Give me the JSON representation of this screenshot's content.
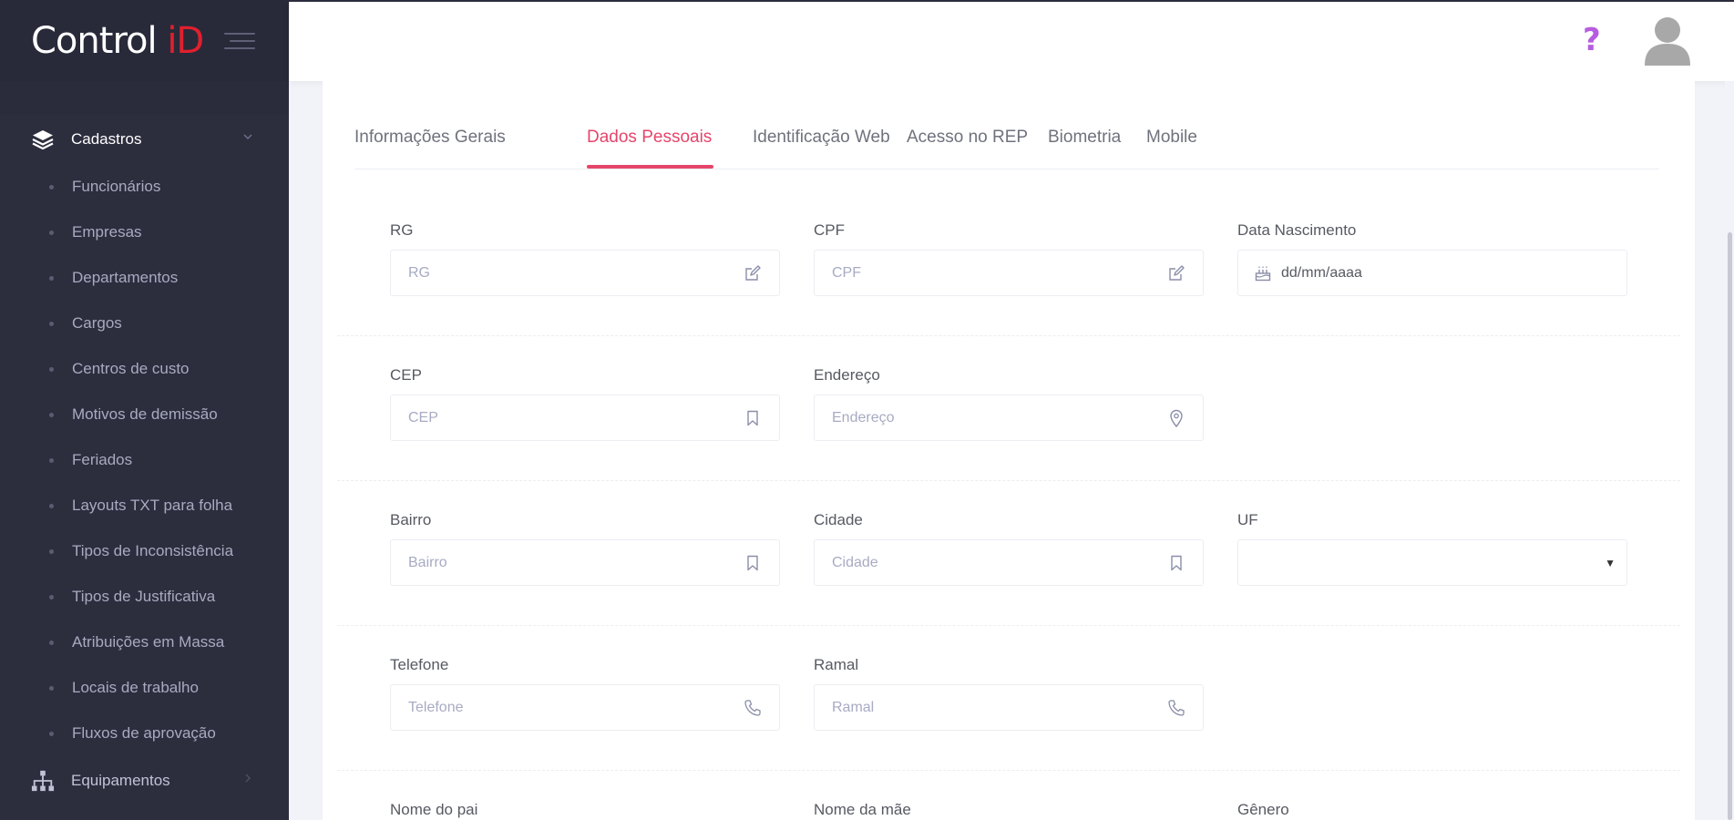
{
  "app": {
    "brand_main": "Control ",
    "brand_accent": "iD"
  },
  "sidebar": {
    "sections": [
      {
        "label": "Cadastros",
        "expanded": true,
        "items": [
          "Funcionários",
          "Empresas",
          "Departamentos",
          "Cargos",
          "Centros de custo",
          "Motivos de demissão",
          "Feriados",
          "Layouts TXT para folha",
          "Tipos de Inconsistência",
          "Tipos de Justificativa",
          "Atribuições em Massa",
          "Locais de trabalho",
          "Fluxos de aprovação"
        ]
      },
      {
        "label": "Equipamentos",
        "expanded": false
      }
    ]
  },
  "header": {
    "help_icon": "?"
  },
  "tabs": [
    "Informações Gerais",
    "Dados Pessoais",
    "Identificação Web",
    "Acesso no REP",
    "Biometria",
    "Mobile"
  ],
  "active_tab": "Dados Pessoais",
  "form": {
    "rg": {
      "label": "RG",
      "placeholder": "RG",
      "icon": "edit-icon"
    },
    "cpf": {
      "label": "CPF",
      "placeholder": "CPF",
      "icon": "edit-icon"
    },
    "birth_date": {
      "label": "Data Nascimento",
      "value": "dd/mm/aaaa",
      "icon": "cake-icon"
    },
    "cep": {
      "label": "CEP",
      "placeholder": "CEP",
      "icon": "bookmark-icon"
    },
    "address": {
      "label": "Endereço",
      "placeholder": "Endereço",
      "icon": "map-pin-icon"
    },
    "district": {
      "label": "Bairro",
      "placeholder": "Bairro",
      "icon": "bookmark-icon"
    },
    "city": {
      "label": "Cidade",
      "placeholder": "Cidade",
      "icon": "bookmark-icon"
    },
    "state": {
      "label": "UF",
      "value": ""
    },
    "phone": {
      "label": "Telefone",
      "placeholder": "Telefone",
      "icon": "phone-icon"
    },
    "extension": {
      "label": "Ramal",
      "placeholder": "Ramal",
      "icon": "phone-icon"
    },
    "father_name": {
      "label": "Nome do pai"
    },
    "mother_name": {
      "label": "Nome da mãe"
    },
    "gender": {
      "label": "Gênero"
    }
  },
  "colors": {
    "sidebar_bg": "#2c2e3e",
    "accent": "#e5456a",
    "brand_red": "#e0202e",
    "help": "#b65de0"
  }
}
